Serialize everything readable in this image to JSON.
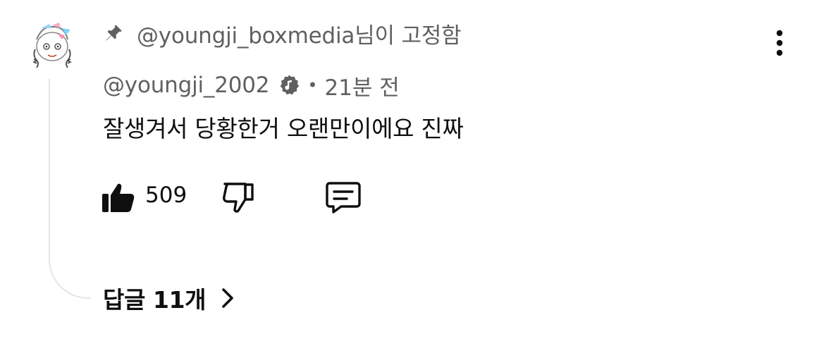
{
  "pinned": {
    "text": "@youngji_boxmedia님이 고정함",
    "icon": "pin-icon"
  },
  "comment": {
    "author": "@youngji_2002",
    "badge_icon": "music-note-verified-icon",
    "separator": "•",
    "time": "21분 전",
    "text": "잘생겨서 당황한거 오랜만이에요 진짜"
  },
  "actions": {
    "like_icon": "thumbs-up-icon",
    "like_count": "509",
    "dislike_icon": "thumbs-down-icon",
    "reply_icon": "comment-icon"
  },
  "replies": {
    "label": "답글 11개",
    "icon": "chevron-right-icon"
  },
  "menu_icon": "more-vertical-icon",
  "colors": {
    "primary_text": "#0f0f0f",
    "secondary_text": "#606060",
    "thread_line": "#e5e5e5"
  }
}
